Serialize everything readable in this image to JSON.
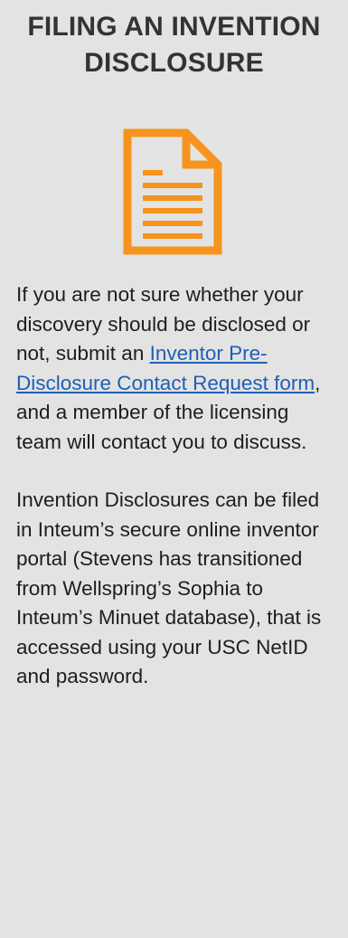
{
  "card": {
    "title": "FILING AN INVENTION DISCLOSURE",
    "icon": "document-icon",
    "accent_color": "#f7941d",
    "background_color": "#e3e3e3",
    "paragraph_1": {
      "before_link": "If you are not sure whether your discovery should be disclosed or not, submit an ",
      "link_text": "Inventor Pre-Disclosure Contact Request form",
      "after_link": ", and a member of the licensing team will contact you to discuss."
    },
    "paragraph_2": "Invention Disclosures can be filed in Inteum’s secure online inventor portal (Stevens has transitioned from Wellspring’s Sophia to Inteum’s Minuet database), that is accessed using your USC NetID and password."
  }
}
